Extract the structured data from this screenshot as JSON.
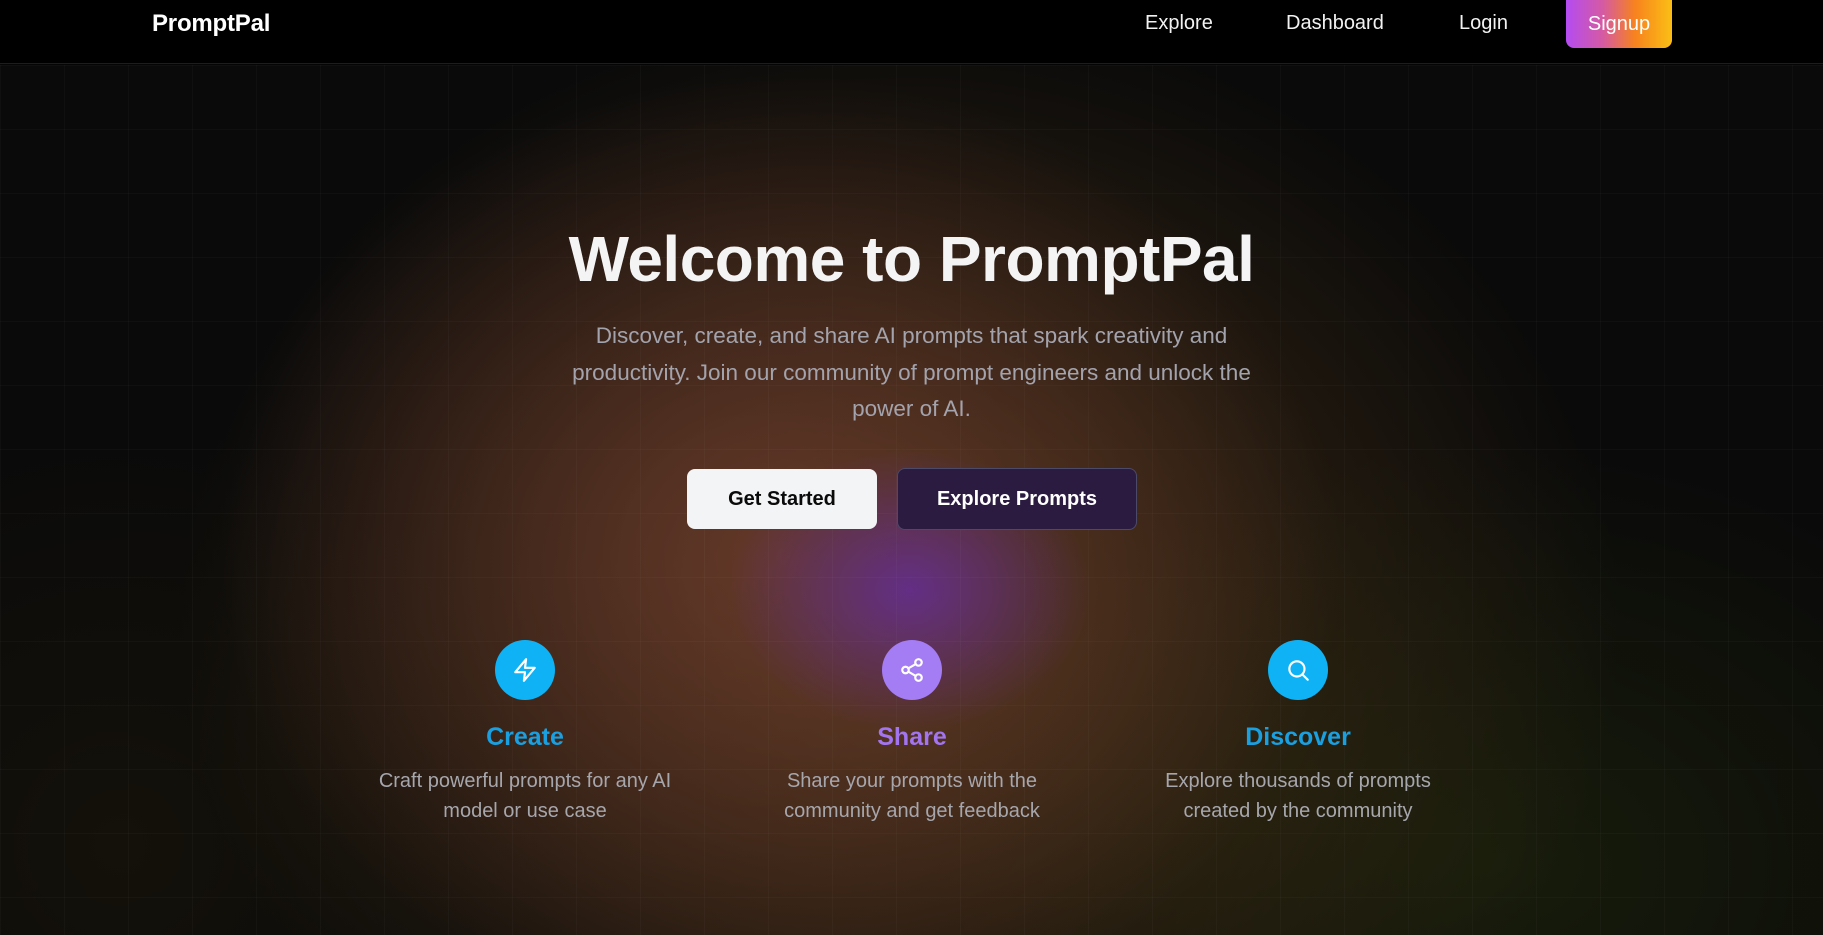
{
  "nav": {
    "brand": "PromptPal",
    "links": [
      "Explore",
      "Dashboard",
      "Login"
    ],
    "signup": "Signup"
  },
  "hero": {
    "title": "Welcome to PromptPal",
    "subtitle": "Discover, create, and share AI prompts that spark creativity and productivity. Join our community of prompt engineers and unlock the power of AI.",
    "primary_button": "Get Started",
    "secondary_button": "Explore Prompts"
  },
  "features": [
    {
      "icon": "lightning-icon",
      "title": "Create",
      "description": "Craft powerful prompts for any AI model or use case",
      "color": "#0ea5e9"
    },
    {
      "icon": "share-icon",
      "title": "Share",
      "description": "Share your prompts with the community and get feedback",
      "color": "#a778f5"
    },
    {
      "icon": "search-icon",
      "title": "Discover",
      "description": "Explore thousands of prompts created by the community",
      "color": "#0ea5e9"
    }
  ],
  "colors": {
    "accent_blue": "#0ea5e9",
    "accent_purple": "#a778f5",
    "signup_gradient_start": "#b44cf2",
    "signup_gradient_end": "#fbbf14"
  }
}
